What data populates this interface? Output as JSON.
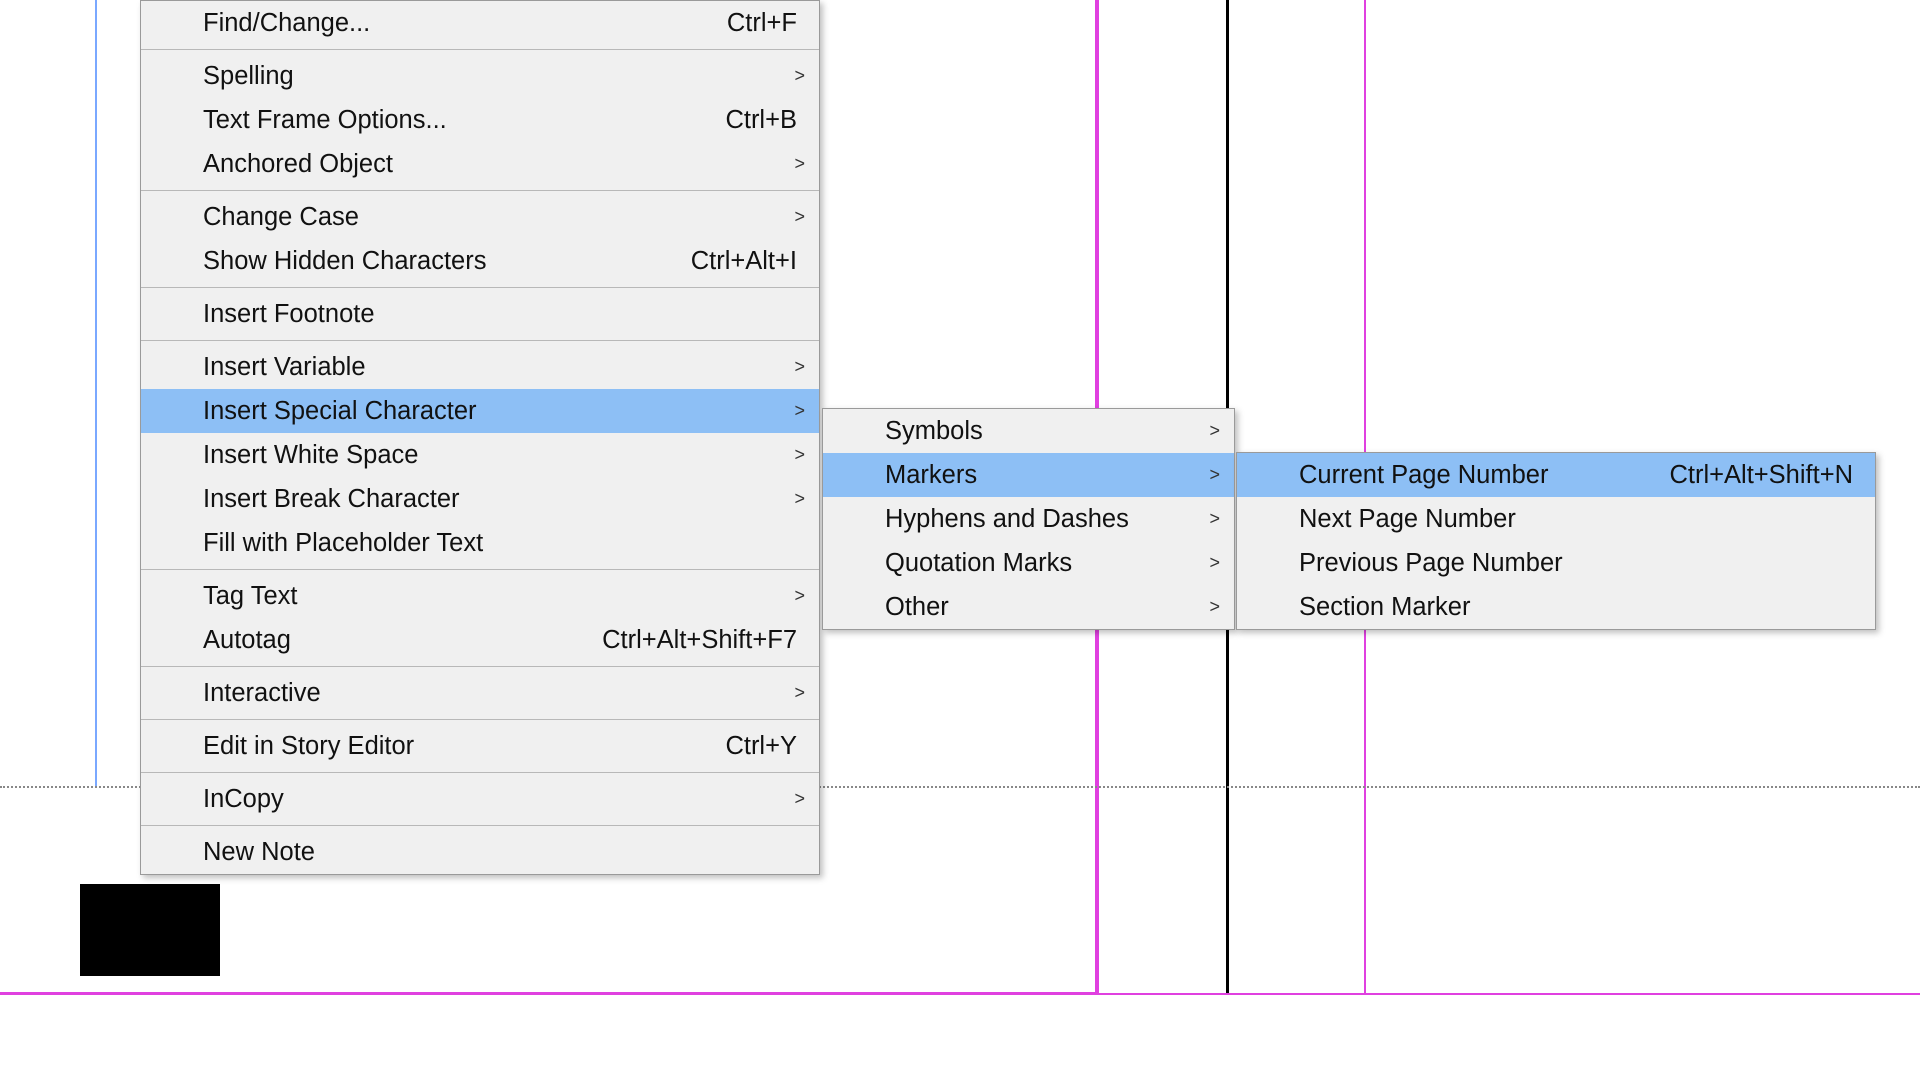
{
  "menu1": {
    "items": [
      {
        "label": "Find/Change...",
        "shortcut": "Ctrl+F"
      },
      {
        "sep": true
      },
      {
        "label": "Spelling",
        "submenu": true
      },
      {
        "label": "Text Frame Options...",
        "shortcut": "Ctrl+B"
      },
      {
        "label": "Anchored Object",
        "submenu": true
      },
      {
        "sep": true
      },
      {
        "label": "Change Case",
        "submenu": true
      },
      {
        "label": "Show Hidden Characters",
        "shortcut": "Ctrl+Alt+I"
      },
      {
        "sep": true
      },
      {
        "label": "Insert Footnote"
      },
      {
        "sep": true
      },
      {
        "label": "Insert Variable",
        "submenu": true
      },
      {
        "label": "Insert Special Character",
        "submenu": true,
        "highlight": true
      },
      {
        "label": "Insert White Space",
        "submenu": true
      },
      {
        "label": "Insert Break Character",
        "submenu": true
      },
      {
        "label": "Fill with Placeholder Text"
      },
      {
        "sep": true
      },
      {
        "label": "Tag Text",
        "submenu": true
      },
      {
        "label": "Autotag",
        "shortcut": "Ctrl+Alt+Shift+F7"
      },
      {
        "sep": true
      },
      {
        "label": "Interactive",
        "submenu": true
      },
      {
        "sep": true
      },
      {
        "label": "Edit in Story Editor",
        "shortcut": "Ctrl+Y"
      },
      {
        "sep": true
      },
      {
        "label": "InCopy",
        "submenu": true
      },
      {
        "sep": true
      },
      {
        "label": "New Note"
      }
    ]
  },
  "menu2": {
    "items": [
      {
        "label": "Symbols",
        "submenu": true
      },
      {
        "label": "Markers",
        "submenu": true,
        "highlight": true
      },
      {
        "label": "Hyphens and Dashes",
        "submenu": true
      },
      {
        "label": "Quotation Marks",
        "submenu": true
      },
      {
        "label": "Other",
        "submenu": true
      }
    ]
  },
  "menu3": {
    "items": [
      {
        "label": "Current Page Number",
        "shortcut": "Ctrl+Alt+Shift+N",
        "highlight": true
      },
      {
        "label": "Next Page Number"
      },
      {
        "label": "Previous Page Number"
      },
      {
        "label": "Section Marker"
      }
    ]
  }
}
